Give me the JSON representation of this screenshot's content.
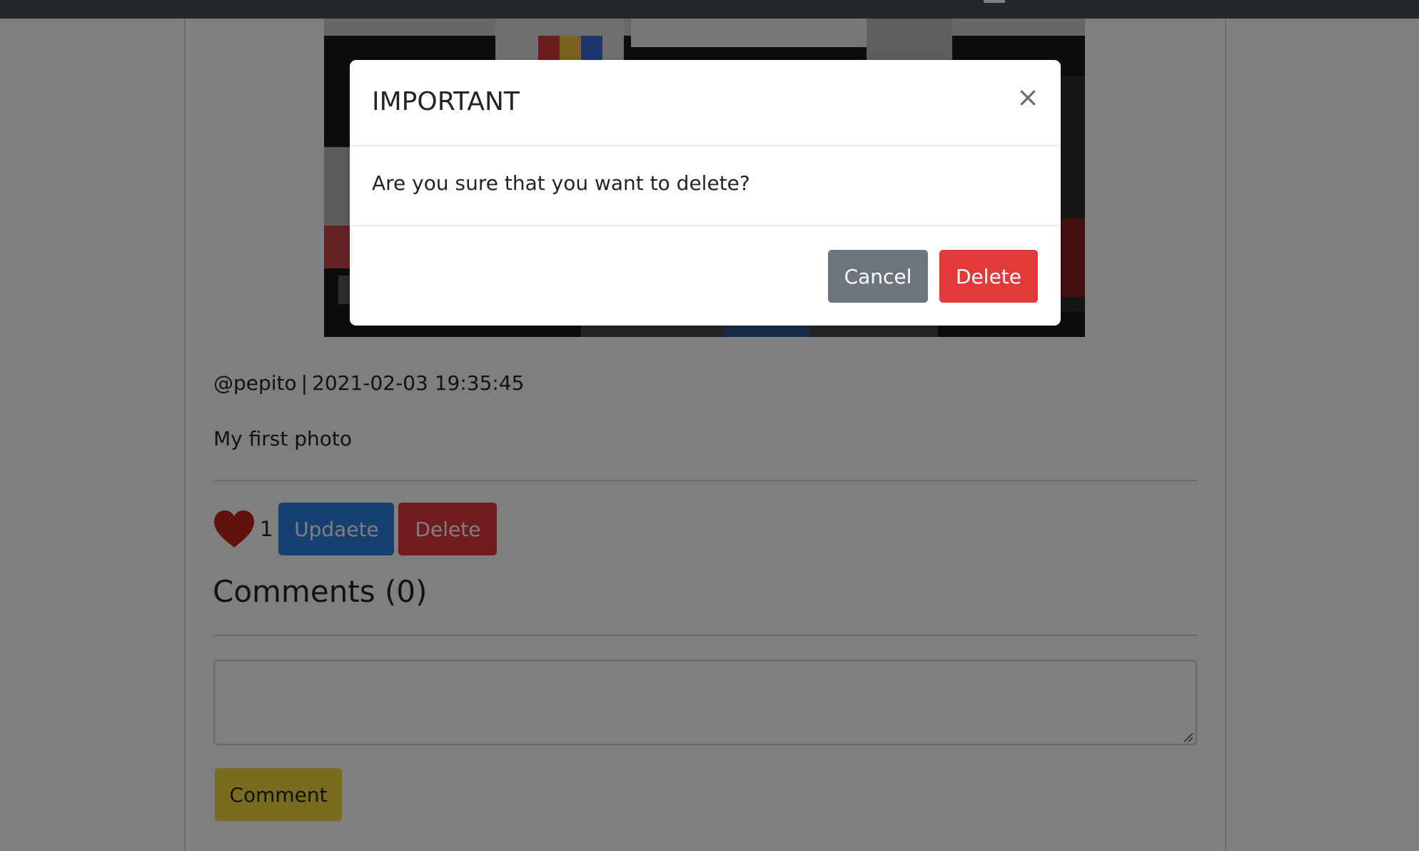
{
  "post": {
    "author": "@pepito",
    "separator": "|",
    "timestamp": "2021-02-03 19:35:45",
    "caption": "My first photo",
    "likes": "1",
    "update_label": "Updaete",
    "delete_label": "Delete"
  },
  "comments": {
    "title": "Comments (0)",
    "input_value": "",
    "submit_label": "Comment"
  },
  "modal": {
    "title": "IMPORTANT",
    "close_glyph": "×",
    "message": "Are you sure that you want to delete?",
    "cancel_label": "Cancel",
    "confirm_label": "Delete"
  },
  "colors": {
    "primary": "#2a81e2",
    "danger": "#e23a3a",
    "secondary": "#6c757d",
    "warning": "#f2d83c",
    "heart": "#c0231d",
    "topbar": "#454e57"
  },
  "icons": {
    "like": "heart-icon",
    "close": "close-icon",
    "resize": "resize-grip-icon"
  }
}
